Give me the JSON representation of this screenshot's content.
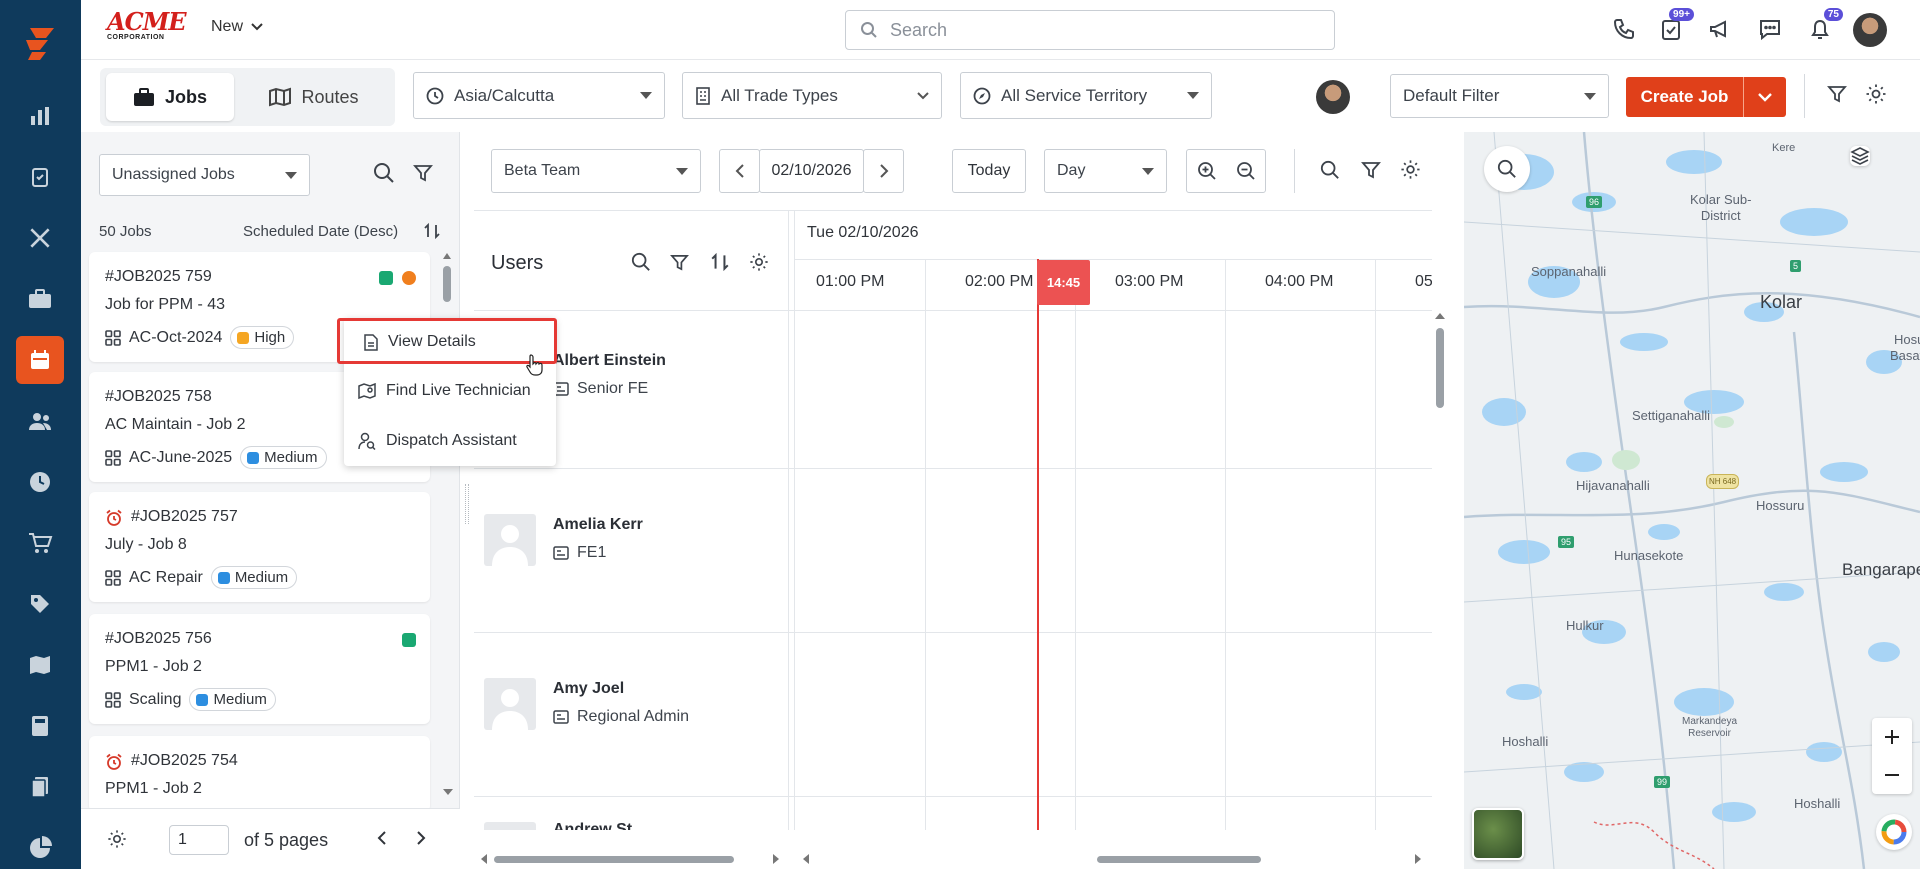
{
  "header": {
    "logo_text": "ACME",
    "logo_sub": "CORPORATION",
    "new_label": "New",
    "search_placeholder": "Search",
    "badges": {
      "tasks": "99+",
      "notifications": "75"
    }
  },
  "toolbar": {
    "tabs": [
      {
        "label": "Jobs"
      },
      {
        "label": "Routes"
      }
    ],
    "timezone": "Asia/Calcutta",
    "trade_types": "All Trade Types",
    "service_territory": "All Service Territory",
    "filter": "Default Filter",
    "create_job": "Create Job"
  },
  "left_panel": {
    "job_filter": "Unassigned Jobs",
    "count": "50 Jobs",
    "sort": "Scheduled Date (Desc)",
    "jobs": [
      {
        "number": "#JOB2025 759",
        "name": "Job for PPM - 43",
        "type": "AC-Oct-2024",
        "priority": "High"
      },
      {
        "number": "#JOB2025 758",
        "name": "AC Maintain - Job 2",
        "type": "AC-June-2025",
        "priority": "Medium"
      },
      {
        "number": "#JOB2025 757",
        "name": "July - Job 8",
        "type": "AC Repair",
        "priority": "Medium"
      },
      {
        "number": "#JOB2025 756",
        "name": "PPM1 - Job 2",
        "type": "Scaling",
        "priority": "Medium"
      },
      {
        "number": "#JOB2025 754",
        "name": "PPM1 - Job 2"
      }
    ],
    "pager": {
      "page": "1",
      "of_pages": "of 5 pages"
    }
  },
  "context_menu": {
    "items": [
      {
        "label": "View Details"
      },
      {
        "label": "Find Live Technician"
      },
      {
        "label": "Dispatch Assistant"
      }
    ]
  },
  "schedule": {
    "team": "Beta Team",
    "date": "02/10/2026",
    "today": "Today",
    "view": "Day",
    "users_label": "Users",
    "day_header": "Tue 02/10/2026",
    "now_time": "14:45",
    "time_slots": [
      "01:00 PM",
      "02:00 PM",
      "03:00 PM",
      "04:00 PM",
      "05"
    ],
    "users": [
      {
        "name": "Albert Einstein",
        "role": "Senior FE"
      },
      {
        "name": "Amelia Kerr",
        "role": "FE1"
      },
      {
        "name": "Amy Joel",
        "role": "Regional Admin"
      },
      {
        "name": "Andrew St..."
      }
    ]
  },
  "map": {
    "labels": {
      "kolar_sub": "Kolar Sub-\nDistrict",
      "kolar": "Kolar",
      "soppanahalli": "Soppanahalli",
      "settiganahalli": "Settiganahalli",
      "hijavanahalli": "Hijavanahalli",
      "hossuru": "Hossuru",
      "hunasekote": "Hunasekote",
      "bangarapet": "Bangarapet",
      "hulkur": "Hulkur",
      "hoshalli1": "Hoshalli",
      "hoshalli2": "Hoshalli",
      "markandeya": "Markandeya\nReservoir",
      "kere": "Kere",
      "hosu": "Hosu",
      "basav": "Basava"
    },
    "road_numbers": [
      "96",
      "5",
      "95",
      "99",
      "NH 648"
    ]
  },
  "colors": {
    "nav_bg": "#0f3a5c",
    "accent": "#e8541f",
    "create_btn": "#e0401a",
    "now_line": "#e53935",
    "priority_high": "#f5a623",
    "priority_medium": "#2d8ee0",
    "status_green": "#1aa872",
    "status_orange": "#f07f1e"
  }
}
